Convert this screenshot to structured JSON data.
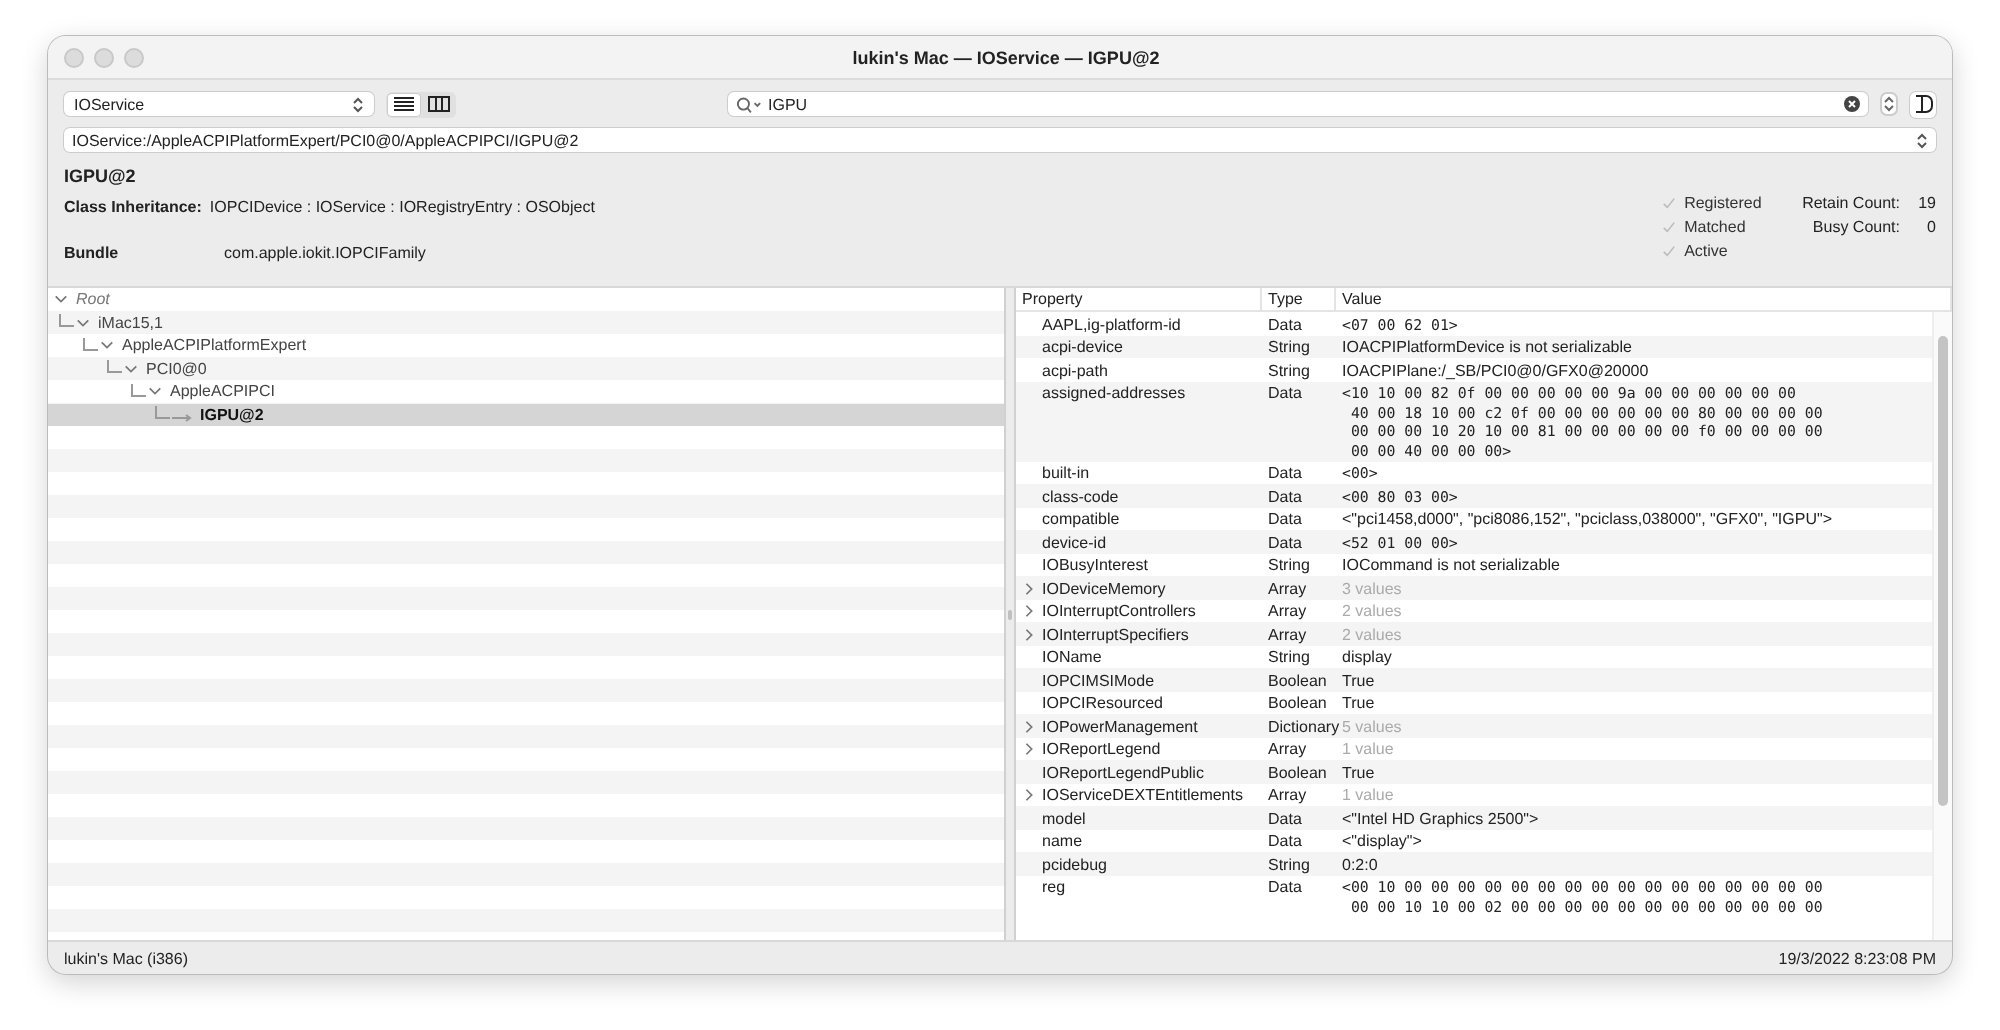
{
  "window": {
    "title": "lukin's Mac — IOService — IGPU@2"
  },
  "toolbar": {
    "plane": "IOService",
    "views": [
      {
        "kind": "list",
        "selected": true
      },
      {
        "kind": "columns",
        "selected": false
      }
    ],
    "search": {
      "value": "IGPU"
    }
  },
  "path": "IOService:/AppleACPIPlatformExpert/PCI0@0/AppleACPIPCI/IGPU@2",
  "info": {
    "name": "IGPU@2",
    "inheritance_label": "Class Inheritance:",
    "inheritance": "IOPCIDevice : IOService : IORegistryEntry : OSObject",
    "bundle_label": "Bundle",
    "bundle": "com.apple.iokit.IOPCIFamily",
    "flags": [
      {
        "label": "Registered",
        "checked": true
      },
      {
        "label": "Matched",
        "checked": true
      },
      {
        "label": "Active",
        "checked": true
      }
    ],
    "counts": [
      {
        "label": "Retain Count:",
        "value": "19"
      },
      {
        "label": "Busy Count:",
        "value": "0"
      }
    ]
  },
  "tree": [
    {
      "label": "Root",
      "expanded": true,
      "selected": false,
      "children": [
        {
          "label": "iMac15,1",
          "expanded": true,
          "selected": false,
          "children": [
            {
              "label": "AppleACPIPlatformExpert",
              "expanded": true,
              "selected": false,
              "children": [
                {
                  "label": "PCI0@0",
                  "expanded": true,
                  "selected": false,
                  "children": [
                    {
                      "label": "AppleACPIPCI",
                      "expanded": true,
                      "selected": false,
                      "children": [
                        {
                          "label": "IGPU@2",
                          "selected": true
                        }
                      ]
                    }
                  ]
                }
              ]
            }
          ]
        }
      ]
    }
  ],
  "table": {
    "columns": [
      "Property",
      "Type",
      "Value"
    ],
    "rows": [
      {
        "kind": "hex",
        "property": "AAPL,ig-platform-id",
        "type": "Data",
        "value": "<07 00 62 01>"
      },
      {
        "kind": "text",
        "property": "acpi-device",
        "type": "String",
        "value": "IOACPIPlatformDevice is not serializable"
      },
      {
        "kind": "text",
        "property": "acpi-path",
        "type": "String",
        "value": "IOACPIPlane:/_SB/PCI0@0/GFX0@20000"
      },
      {
        "kind": "hex",
        "property": "assigned-addresses",
        "type": "Data",
        "value": "<10 10 00 82 0f 00 00 00 00 00 9a 00 00 00 00 00 00\n 40 00 18 10 00 c2 0f 00 00 00 00 00 00 80 00 00 00 00\n 00 00 00 10 20 10 00 81 00 00 00 00 00 f0 00 00 00 00\n 00 00 40 00 00 00>"
      },
      {
        "kind": "hex",
        "property": "built-in",
        "type": "Data",
        "value": "<00>"
      },
      {
        "kind": "hex",
        "property": "class-code",
        "type": "Data",
        "value": "<00 80 03 00>"
      },
      {
        "kind": "text",
        "property": "compatible",
        "type": "Data",
        "value": "<\"pci1458,d000\", \"pci8086,152\", \"pciclass,038000\", \"GFX0\", \"IGPU\">"
      },
      {
        "kind": "hex",
        "property": "device-id",
        "type": "Data",
        "value": "<52 01 00 00>"
      },
      {
        "kind": "text",
        "property": "IOBusyInterest",
        "type": "String",
        "value": "IOCommand is not serializable"
      },
      {
        "kind": "collection",
        "property": "IODeviceMemory",
        "type": "Array",
        "value": "3 values"
      },
      {
        "kind": "collection",
        "property": "IOInterruptControllers",
        "type": "Array",
        "value": "2 values"
      },
      {
        "kind": "collection",
        "property": "IOInterruptSpecifiers",
        "type": "Array",
        "value": "2 values"
      },
      {
        "kind": "text",
        "property": "IOName",
        "type": "String",
        "value": "display"
      },
      {
        "kind": "text",
        "property": "IOPCIMSIMode",
        "type": "Boolean",
        "value": "True"
      },
      {
        "kind": "text",
        "property": "IOPCIResourced",
        "type": "Boolean",
        "value": "True"
      },
      {
        "kind": "collection",
        "property": "IOPowerManagement",
        "type": "Dictionary",
        "value": "5 values"
      },
      {
        "kind": "collection",
        "property": "IOReportLegend",
        "type": "Array",
        "value": "1 value"
      },
      {
        "kind": "text",
        "property": "IOReportLegendPublic",
        "type": "Boolean",
        "value": "True"
      },
      {
        "kind": "collection",
        "property": "IOServiceDEXTEntitlements",
        "type": "Array",
        "value": "1 value"
      },
      {
        "kind": "text",
        "property": "model",
        "type": "Data",
        "value": "<\"Intel HD Graphics 2500\">"
      },
      {
        "kind": "text",
        "property": "name",
        "type": "Data",
        "value": "<\"display\">"
      },
      {
        "kind": "text",
        "property": "pcidebug",
        "type": "String",
        "value": "0:2:0"
      },
      {
        "kind": "hex",
        "property": "reg",
        "type": "Data",
        "value": "<00 10 00 00 00 00 00 00 00 00 00 00 00 00 00 00 00 00\n 00 00 10 10 00 02 00 00 00 00 00 00 00 00 00 00 00 00"
      }
    ]
  },
  "status_bar": {
    "machine": "lukin's Mac (i386)",
    "timestamp": "19/3/2022 8:23:08 PM"
  }
}
